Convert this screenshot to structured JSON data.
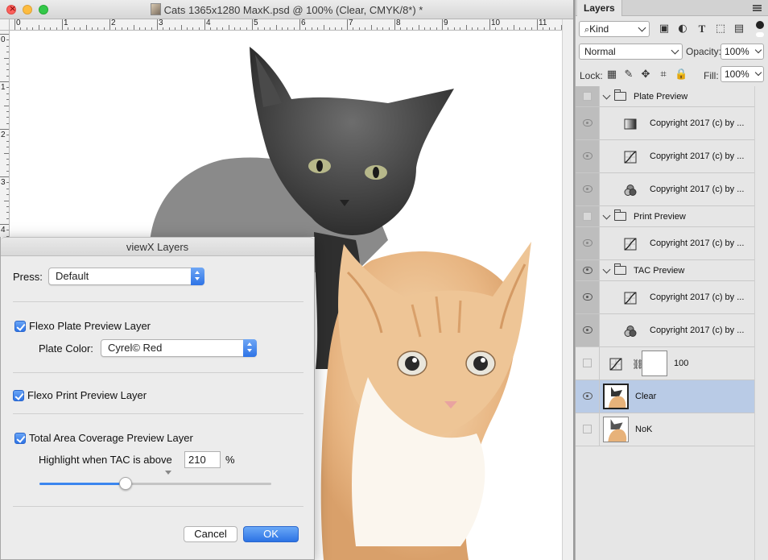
{
  "document": {
    "title": "Cats 1365x1280 MaxK.psd @ 100% (Clear, CMYK/8*) *",
    "ruler_top_labels": [
      "0",
      "1",
      "2",
      "3",
      "4",
      "5",
      "6",
      "7",
      "8",
      "9",
      "10",
      "11"
    ],
    "ruler_left_labels": [
      "0",
      "1",
      "2",
      "3",
      "4"
    ]
  },
  "layers_panel": {
    "tab_label": "Layers",
    "filter_kind": "Kind",
    "blend_mode": "Normal",
    "opacity_label": "Opacity:",
    "opacity_value": "100%",
    "lock_label": "Lock:",
    "fill_label": "Fill:",
    "fill_value": "100%",
    "layers": [
      {
        "type": "group",
        "name": "Plate Preview",
        "visible": false
      },
      {
        "type": "layer",
        "name": "Copyright 2017 (c) by ...",
        "icon": "gradient-fill-icon",
        "visible": true
      },
      {
        "type": "layer",
        "name": "Copyright 2017 (c) by ...",
        "icon": "curves-icon",
        "visible": true
      },
      {
        "type": "layer",
        "name": "Copyright 2017 (c) by ...",
        "icon": "channel-mixer-icon",
        "visible": true
      },
      {
        "type": "group",
        "name": "Print Preview",
        "visible": false
      },
      {
        "type": "layer",
        "name": "Copyright 2017 (c) by ...",
        "icon": "curves-icon",
        "visible": true
      },
      {
        "type": "group",
        "name": "TAC Preview",
        "visible": true
      },
      {
        "type": "layer",
        "name": "Copyright 2017 (c) by ...",
        "icon": "curves-icon",
        "visible": true
      },
      {
        "type": "layer",
        "name": "Copyright 2017 (c) by ...",
        "icon": "channel-mixer-icon",
        "visible": true
      },
      {
        "type": "masked",
        "name": "100",
        "visible": false
      },
      {
        "type": "pixel",
        "name": "Clear",
        "visible": true,
        "selected": true
      },
      {
        "type": "pixel",
        "name": "NoK",
        "visible": false
      }
    ]
  },
  "dialog": {
    "title": "viewX Layers",
    "press_label": "Press:",
    "press_value": "Default",
    "plate_preview_label": "Flexo Plate Preview Layer",
    "plate_preview_checked": true,
    "plate_color_label": "Plate Color:",
    "plate_color_value": "Cyrel© Red",
    "print_preview_label": "Flexo Print Preview Layer",
    "print_preview_checked": true,
    "tac_label": "Total Area Coverage Preview Layer",
    "tac_checked": true,
    "highlight_label": "Highlight when TAC is above",
    "tac_value": "210",
    "tac_unit": "%",
    "slider_fraction": 0.37,
    "cancel_label": "Cancel",
    "ok_label": "OK"
  },
  "colors": {
    "accent": "#2e74e6",
    "selection": "#b9cbe6",
    "close": "#fc605c",
    "minimize": "#fdbc40",
    "maximize": "#34c84a"
  }
}
